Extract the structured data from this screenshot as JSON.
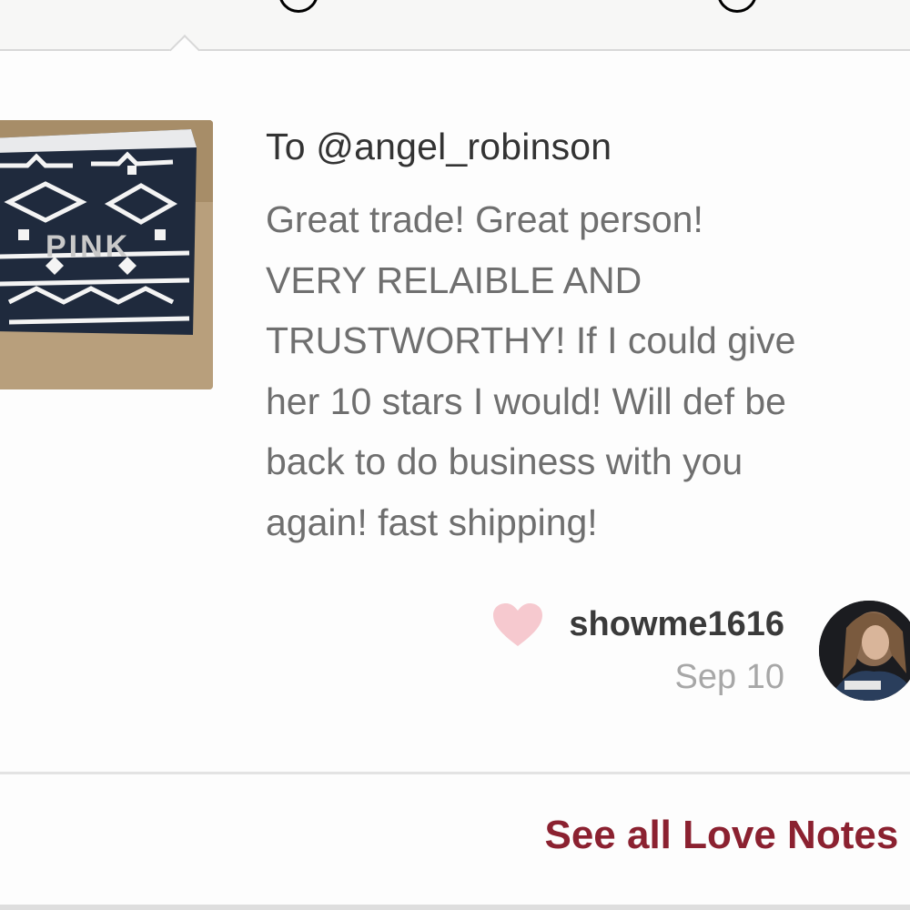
{
  "note": {
    "recipient": "To @angel_robinson",
    "body": "Great trade! Great person!\nVERY RELAIBLE AND\nTRUSTWORTHY! If I could give\nher 10 stars I would! Will def be\nback to do business with you\nagain! fast shipping!"
  },
  "author": {
    "username": "showme1616",
    "date": "Sep 10",
    "heart_icon": "heart-icon"
  },
  "thumbnail": {
    "text": "PINK"
  },
  "footer": {
    "link_label": "See all Love Notes »"
  },
  "colors": {
    "accent": "#8b2130",
    "heart": "#f6c9cf",
    "text_dark": "#333333",
    "text_muted": "#6f6f6f",
    "date": "#a7a7a7"
  }
}
